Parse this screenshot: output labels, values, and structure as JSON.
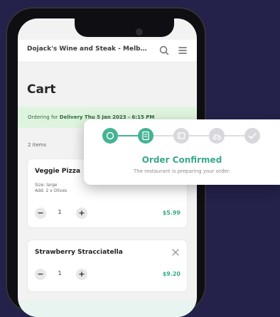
{
  "phone": {
    "header": {
      "restaurant_name": "Dojack's Wine and Steak - Melbo..."
    },
    "cart": {
      "title": "Cart",
      "ordering_prefix": "Ordering for ",
      "ordering_details": "Delivery Thu 5 Jan 2023 - 6:15 PM",
      "items_count": "2 items",
      "items": [
        {
          "name": "Veggie Pizza",
          "lines": [
            "Size: large",
            "Add: 2 x Olives"
          ],
          "quantity": "1",
          "price": "$5.99"
        },
        {
          "name": "Strawberry Stracciatella",
          "lines": [],
          "quantity": "1",
          "price": "$9.20"
        }
      ]
    }
  },
  "status_popover": {
    "title": "Order Confirmed",
    "description": "The restaurant is preparing your order.",
    "steps": [
      {
        "name": "placed",
        "active": true
      },
      {
        "name": "confirmed",
        "active": true
      },
      {
        "name": "preparing",
        "active": false
      },
      {
        "name": "delivering",
        "active": false
      },
      {
        "name": "complete",
        "active": false
      }
    ],
    "colors": {
      "active": "#45b394",
      "inactive": "#d7d7dc",
      "line_active": "#45b394",
      "line_inactive": "#dddddd"
    }
  },
  "colors": {
    "background": "#24214a",
    "accent": "#38a988",
    "banner_bg": "#dff4df"
  }
}
